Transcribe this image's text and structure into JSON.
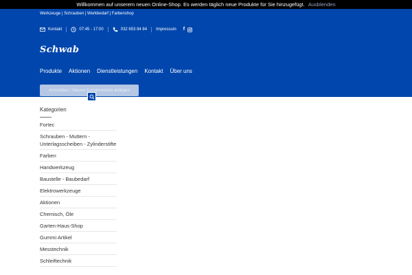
{
  "notice": {
    "text": "Willkommen auf unserem neuen Online-Shop. Es werden täglich neue Produkte für Sie hinzugefügt.",
    "dismiss": "Ausblenden"
  },
  "header": {
    "tagline": "Werkzeuge | Schrauben | Werkbedarf | Farbenshop",
    "contact_label": "Kontakt",
    "hours": "07:45 - 17:00",
    "phone": "032 653 84 84",
    "impressum": "Impressum",
    "social": [
      "facebook-icon",
      "instagram-icon"
    ],
    "logo_text": "Schwab"
  },
  "nav": {
    "items": [
      {
        "label": "Produkte"
      },
      {
        "label": "Aktionen"
      },
      {
        "label": "Dienstleistungen"
      },
      {
        "label": "Kontakt"
      },
      {
        "label": "Über uns"
      }
    ],
    "dropdown": "Anmelden / Neues Kundenkonto anlegen"
  },
  "sidebar": {
    "title": "Kategorien",
    "categories": [
      "Fortec",
      "Schrauben - Muttern - Unterlagsscheiben - Zylinderstifte",
      "Farben",
      "Handwerkzeug",
      "Baustelle - Baubedarf",
      "Elektrowerkzeuge",
      "Aktionen",
      "Chemisch, Öle",
      "Garten-Haus-Shop",
      "Gummi Artikel",
      "Messtechnik",
      "Schleiftechnik"
    ]
  },
  "colors": {
    "header_blue": "#0046ad",
    "notice_bg": "#000000",
    "dismiss_link": "#9aa5c4"
  }
}
